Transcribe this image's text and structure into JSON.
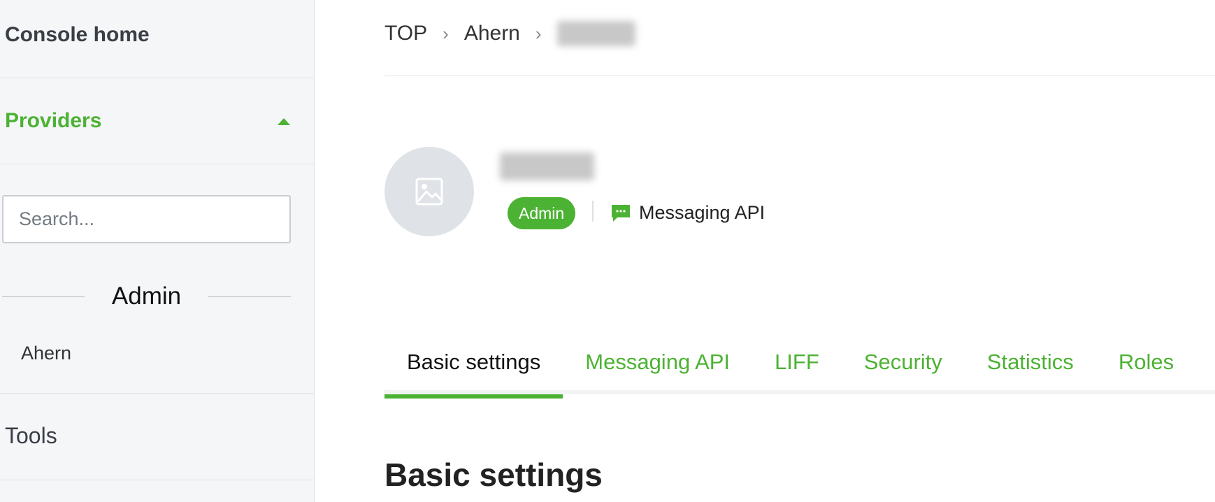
{
  "sidebar": {
    "console_home": "Console home",
    "providers_label": "Providers",
    "search": {
      "placeholder": "Search..."
    },
    "role_group": "Admin",
    "providers": [
      "Ahern"
    ],
    "tools_label": "Tools"
  },
  "breadcrumb": {
    "items": [
      "TOP",
      "Ahern"
    ]
  },
  "channel": {
    "role_badge": "Admin",
    "type": "Messaging API"
  },
  "tabs": [
    {
      "label": "Basic settings",
      "active": true
    },
    {
      "label": "Messaging API",
      "active": false
    },
    {
      "label": "LIFF",
      "active": false
    },
    {
      "label": "Security",
      "active": false
    },
    {
      "label": "Statistics",
      "active": false
    },
    {
      "label": "Roles",
      "active": false
    }
  ],
  "page_title": "Basic settings",
  "colors": {
    "accent": "#4cb233",
    "sidebar_bg": "#f4f6f8",
    "avatar_bg": "#dfe2e6"
  }
}
